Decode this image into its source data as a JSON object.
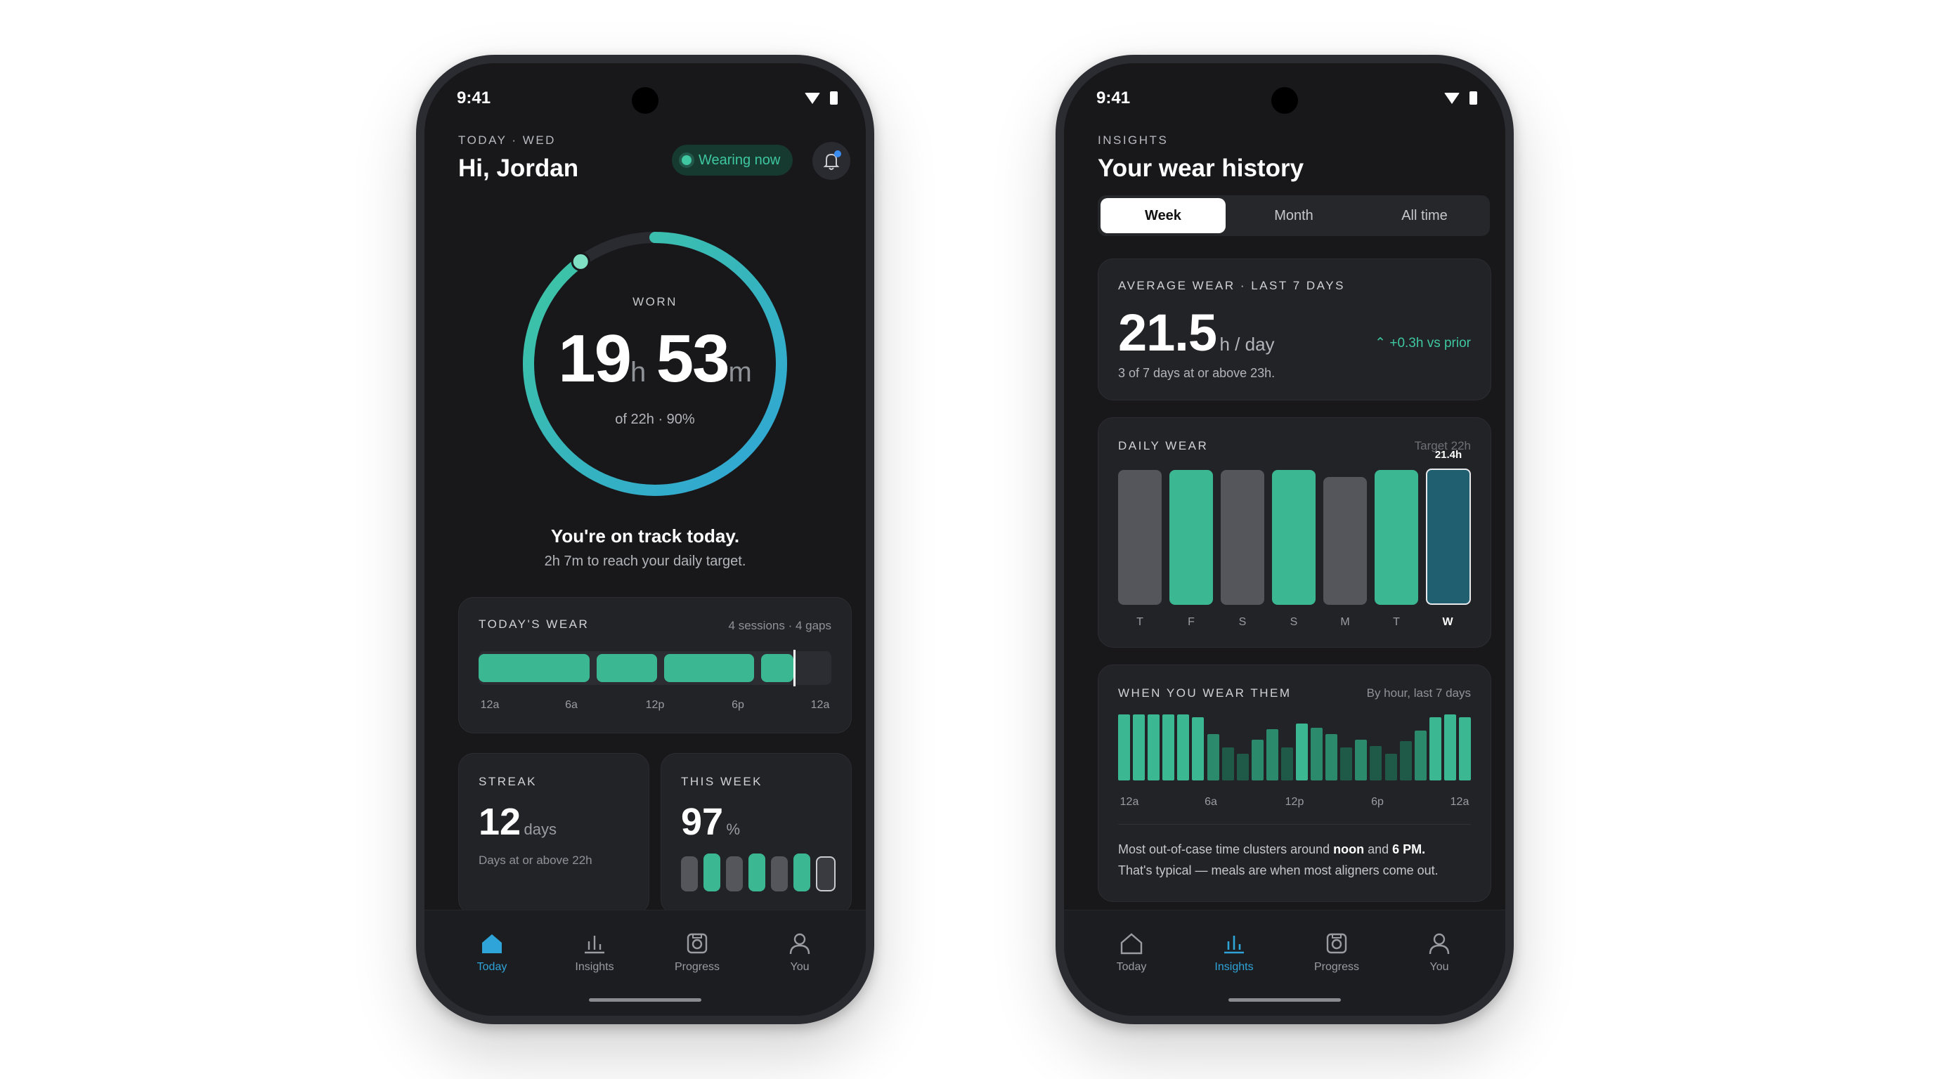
{
  "colors": {
    "accent_green": "#3ec7a0",
    "accent_blue": "#2fa4d8",
    "background": "#18181b",
    "card": "#222327"
  },
  "left": {
    "time": "9:41",
    "eyebrow": "TODAY · WED",
    "greeting": "Hi, Jordan",
    "wearing_badge": "Wearing now",
    "ring": {
      "label": "WORN",
      "hours": "19",
      "hours_unit": "h",
      "minutes": "53",
      "minutes_unit": "m",
      "sub": "of 22h · 90%",
      "progress_fraction": 0.9
    },
    "status_title": "You're on track today.",
    "status_sub": "2h 7m to reach your daily target.",
    "todays_wear": {
      "label": "TODAY'S WEAR",
      "meta": "4 sessions · 4 gaps",
      "ticks": [
        "12a",
        "6a",
        "12p",
        "6p",
        "12a"
      ]
    },
    "streak": {
      "label": "STREAK",
      "value": "12",
      "unit": "days",
      "sub": "Days at or above 22h"
    },
    "this_week": {
      "label": "THIS WEEK",
      "value": "97",
      "unit": "%"
    },
    "nav": [
      {
        "label": "Today",
        "icon": "home-icon",
        "active": true
      },
      {
        "label": "Insights",
        "icon": "bar-chart-icon",
        "active": false
      },
      {
        "label": "Progress",
        "icon": "progress-icon",
        "active": false
      },
      {
        "label": "You",
        "icon": "person-icon",
        "active": false
      }
    ]
  },
  "right": {
    "time": "9:41",
    "eyebrow": "INSIGHTS",
    "title": "Your wear history",
    "tabs": [
      "Week",
      "Month",
      "All time"
    ],
    "selected_tab": "Week",
    "average": {
      "label": "AVERAGE WEAR · LAST 7 DAYS",
      "value": "21.5",
      "unit": "h / day",
      "delta": "+0.3h vs prior",
      "sub": "3 of 7 days at or above 23h."
    },
    "daily_wear": {
      "label": "DAILY WEAR",
      "target_label": "Target 22h",
      "selected_value": "21.4h",
      "days": [
        "T",
        "F",
        "S",
        "S",
        "M",
        "T",
        "W"
      ]
    },
    "when_you_wear": {
      "label": "WHEN YOU WEAR THEM",
      "meta": "By hour, last 7 days",
      "ticks": [
        "12a",
        "6a",
        "12p",
        "6p",
        "12a"
      ],
      "note_line1_a": "Most out-of-case time clusters around ",
      "note_noon": "noon",
      "note_and": " and ",
      "note_6pm": "6 PM.",
      "note_line2": "That's typical — meals are when most aligners come out."
    },
    "nav": [
      {
        "label": "Today",
        "icon": "home-icon",
        "active": false
      },
      {
        "label": "Insights",
        "icon": "bar-chart-icon",
        "active": true
      },
      {
        "label": "Progress",
        "icon": "progress-icon",
        "active": false
      },
      {
        "label": "You",
        "icon": "person-icon",
        "active": false
      }
    ]
  }
}
